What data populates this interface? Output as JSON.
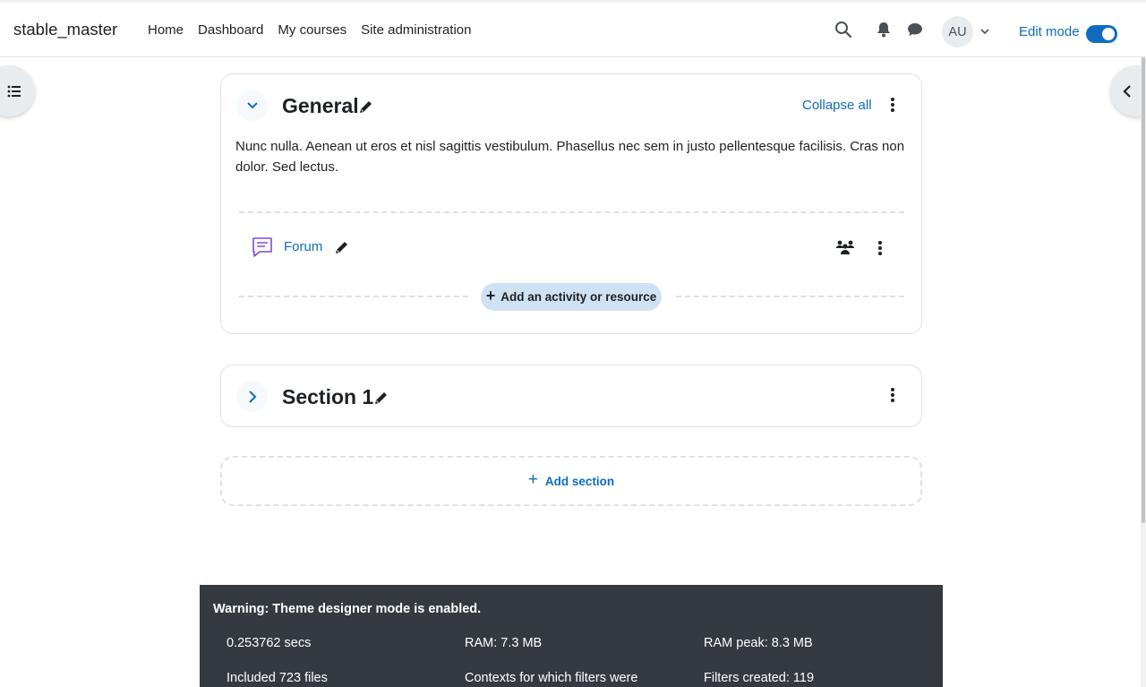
{
  "navbar": {
    "brand": "stable_master",
    "links": [
      "Home",
      "Dashboard",
      "My courses",
      "Site administration"
    ],
    "avatar_initials": "AU",
    "edit_mode_label": "Edit mode",
    "edit_mode_on": true
  },
  "sections": {
    "general": {
      "title": "General",
      "collapse_all": "Collapse all",
      "summary": "Nunc nulla. Aenean ut eros et nisl sagittis vestibulum. Phasellus nec sem in justo pellentesque facilisis. Cras non dolor. Sed lectus.",
      "activity": {
        "name": "Forum"
      },
      "add_activity_label": "Add an activity or resource"
    },
    "section1": {
      "title": "Section 1"
    },
    "add_section_label": "Add section"
  },
  "perf": {
    "warning": "Warning: Theme designer mode is enabled.",
    "row1": [
      "0.253762 secs",
      "RAM: 7.3 MB",
      "RAM peak: 8.3 MB"
    ],
    "row2": [
      "Included 723 files",
      "Contexts for which filters were",
      "Filters created: 119"
    ]
  },
  "colors": {
    "link": "#0f6cbf",
    "toggle_on": "#0f6cbf",
    "footer_bg": "#343a40",
    "forum_icon": "#7e4bd1"
  }
}
